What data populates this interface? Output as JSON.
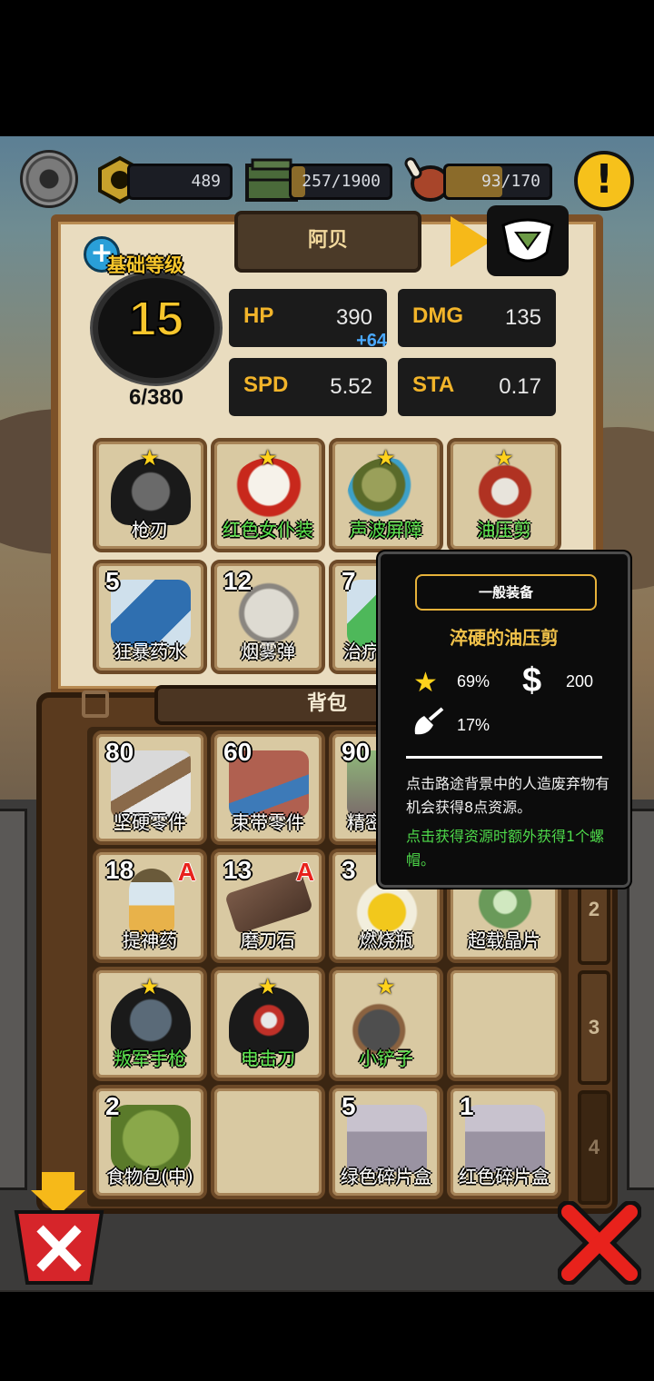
{
  "hud": {
    "bolts": "489",
    "crates": "257/1900",
    "crates_fill": 0.135,
    "food": "93/170",
    "food_fill": 0.547,
    "alert_symbol": "!",
    "icons": [
      "gear-icon",
      "bolt-nut-icon",
      "ammo-crate-icon",
      "meat-icon",
      "alert-icon"
    ]
  },
  "character": {
    "name": "阿贝",
    "level_label": "基础等级",
    "level": "15",
    "exp": "6/380",
    "stats": [
      {
        "key": "HP",
        "value": "390",
        "bonus": "+64"
      },
      {
        "key": "DMG",
        "value": "135",
        "bonus": ""
      },
      {
        "key": "SPD",
        "value": "5.52",
        "bonus": ""
      },
      {
        "key": "STA",
        "value": "0.17",
        "bonus": ""
      }
    ]
  },
  "equipment": [
    {
      "label": "枪刃",
      "starred": true,
      "green": false
    },
    {
      "label": "红色女仆装",
      "starred": true,
      "green": true
    },
    {
      "label": "声波屏障",
      "starred": true,
      "green": true
    },
    {
      "label": "油压剪",
      "starred": true,
      "green": true
    }
  ],
  "consumables": [
    {
      "label": "狂暴药水",
      "count": "5"
    },
    {
      "label": "烟雾弹",
      "count": "12"
    },
    {
      "label": "治疗",
      "count": "7"
    }
  ],
  "backpack": {
    "title": "背包",
    "page_tabs": [
      "2",
      "3",
      "4"
    ],
    "items": [
      {
        "label": "坚硬零件",
        "count": "80",
        "green": false,
        "starred": false,
        "tag": ""
      },
      {
        "label": "束带零件",
        "count": "60",
        "green": false,
        "starred": false,
        "tag": ""
      },
      {
        "label": "精密",
        "count": "90",
        "green": false,
        "starred": false,
        "tag": ""
      },
      {
        "label": "",
        "count": "",
        "green": false,
        "starred": false,
        "tag": ""
      },
      {
        "label": "提神药",
        "count": "18",
        "green": false,
        "starred": false,
        "tag": "A"
      },
      {
        "label": "磨刀石",
        "count": "13",
        "green": false,
        "starred": false,
        "tag": "A"
      },
      {
        "label": "燃烧瓶",
        "count": "3",
        "green": false,
        "starred": false,
        "tag": ""
      },
      {
        "label": "超载晶片",
        "count": "",
        "green": false,
        "starred": false,
        "tag": ""
      },
      {
        "label": "叛军手枪",
        "count": "",
        "green": true,
        "starred": true,
        "tag": ""
      },
      {
        "label": "电击刀",
        "count": "",
        "green": true,
        "starred": true,
        "tag": ""
      },
      {
        "label": "小铲子",
        "count": "",
        "green": true,
        "starred": true,
        "tag": ""
      },
      {
        "label": "",
        "count": "",
        "green": false,
        "starred": false,
        "tag": ""
      },
      {
        "label": "食物包(中)",
        "count": "2",
        "green": false,
        "starred": false,
        "tag": ""
      },
      {
        "label": "",
        "count": "",
        "green": false,
        "starred": false,
        "tag": ""
      },
      {
        "label": "绿色碎片盒",
        "count": "5",
        "green": false,
        "starred": false,
        "tag": ""
      },
      {
        "label": "红色碎片盒",
        "count": "1",
        "green": false,
        "starred": false,
        "tag": ""
      }
    ]
  },
  "tooltip": {
    "rarity": "一般装备",
    "item_name": "淬硬的油压剪",
    "star_chance": "69%",
    "price": "200",
    "dig_chance": "17%",
    "description": "点击路途背景中的人造废弃物有机会获得8点资源。",
    "bonus": "点击获得资源时额外获得1个螺帽。"
  },
  "colors": {
    "accent": "#f7c62c",
    "green_text": "#56e04a",
    "close_red": "#e8221c"
  }
}
